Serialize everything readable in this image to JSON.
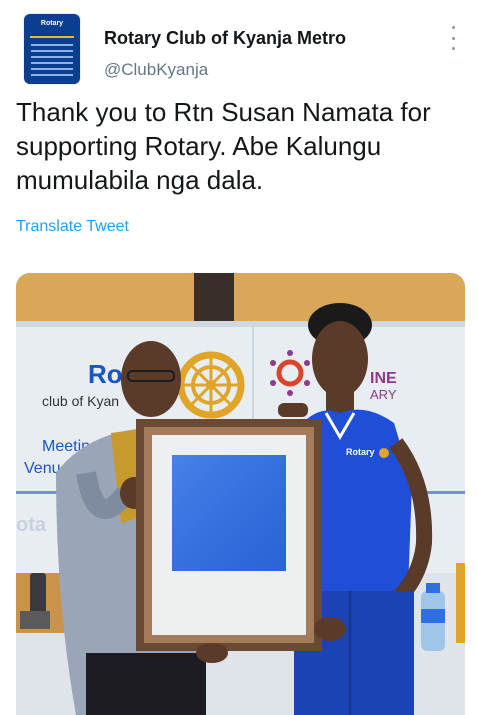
{
  "account": {
    "avatar_icon": "rotary-club-avatar-icon",
    "avatar_text": "Rotary",
    "display_name": "Rotary Club of Kyanja Metro",
    "handle": "@ClubKyanja"
  },
  "tweet": {
    "text": "Thank you to Rtn Susan Namata for supporting Rotary. Abe Kalungu mumulabila nga dala.",
    "translate_label": "Translate Tweet",
    "more_icon": "more-vertical-icon"
  },
  "photo": {
    "banner_texts": [
      "Ro",
      "club of Kyan",
      "Meetin",
      "Venu",
      "INE",
      "ARY",
      "ota"
    ],
    "shirt_text": "Rotary",
    "colors": {
      "wall": "#d9a75a",
      "banner": "#e8edf2",
      "rotary_blue": "#1a55c7",
      "rotary_gold": "#e0a528",
      "shirt": "#1f4fd6",
      "frame": "#6b4a34",
      "artwork": "#2f6fe0"
    }
  },
  "colors": {
    "link": "#1da1f2",
    "secondary_text": "#657786",
    "primary_text": "#14171a"
  }
}
